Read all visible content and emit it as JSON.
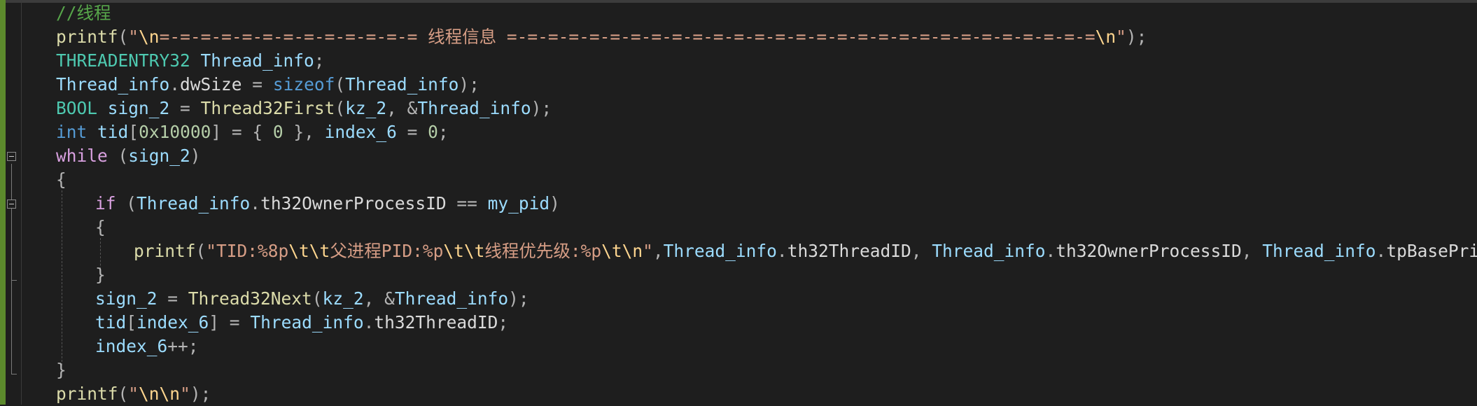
{
  "editor": {
    "lines": [
      {
        "indent": 0,
        "fold": false,
        "tokens": [
          {
            "t": "//线程",
            "c": "cm"
          }
        ]
      },
      {
        "indent": 0,
        "fold": false,
        "tokens": [
          {
            "t": "printf",
            "c": "fn"
          },
          {
            "t": "(",
            "c": "pu"
          },
          {
            "t": "\"",
            "c": "st"
          },
          {
            "t": "\\n",
            "c": "es"
          },
          {
            "t": "=-=-=-=-=-=-=-=-=-=-=-=-= 线程信息 =-=-=-=-=-=-=-=-=-=-=-=-=-=-=-=-=-=-=-=-=-=-=-=-=-=-=-=-=",
            "c": "st"
          },
          {
            "t": "\\n",
            "c": "es"
          },
          {
            "t": "\"",
            "c": "st"
          },
          {
            "t": ");",
            "c": "pu"
          }
        ]
      },
      {
        "indent": 0,
        "fold": false,
        "tokens": [
          {
            "t": "THREADENTRY32",
            "c": "ty"
          },
          {
            "t": " ",
            "c": "df"
          },
          {
            "t": "Thread_info",
            "c": "vr"
          },
          {
            "t": ";",
            "c": "pu"
          }
        ]
      },
      {
        "indent": 0,
        "fold": false,
        "tokens": [
          {
            "t": "Thread_info",
            "c": "vr"
          },
          {
            "t": ".",
            "c": "pu"
          },
          {
            "t": "dwSize",
            "c": "mb"
          },
          {
            "t": " = ",
            "c": "pu"
          },
          {
            "t": "sizeof",
            "c": "kw"
          },
          {
            "t": "(",
            "c": "pu"
          },
          {
            "t": "Thread_info",
            "c": "vr"
          },
          {
            "t": ");",
            "c": "pu"
          }
        ]
      },
      {
        "indent": 0,
        "fold": false,
        "tokens": [
          {
            "t": "BOOL",
            "c": "ty"
          },
          {
            "t": " ",
            "c": "df"
          },
          {
            "t": "sign_2",
            "c": "vr"
          },
          {
            "t": " = ",
            "c": "pu"
          },
          {
            "t": "Thread32First",
            "c": "fn"
          },
          {
            "t": "(",
            "c": "pu"
          },
          {
            "t": "kz_2",
            "c": "vr"
          },
          {
            "t": ", &",
            "c": "pu"
          },
          {
            "t": "Thread_info",
            "c": "vr"
          },
          {
            "t": ");",
            "c": "pu"
          }
        ]
      },
      {
        "indent": 0,
        "fold": false,
        "tokens": [
          {
            "t": "int",
            "c": "kw"
          },
          {
            "t": " ",
            "c": "df"
          },
          {
            "t": "tid",
            "c": "vr"
          },
          {
            "t": "[",
            "c": "pu"
          },
          {
            "t": "0x10000",
            "c": "nm"
          },
          {
            "t": "] = { ",
            "c": "pu"
          },
          {
            "t": "0",
            "c": "nm"
          },
          {
            "t": " }, ",
            "c": "pu"
          },
          {
            "t": "index_6",
            "c": "vr"
          },
          {
            "t": " = ",
            "c": "pu"
          },
          {
            "t": "0",
            "c": "nm"
          },
          {
            "t": ";",
            "c": "pu"
          }
        ]
      },
      {
        "indent": 0,
        "fold": true,
        "tokens": [
          {
            "t": "while",
            "c": "ct"
          },
          {
            "t": " (",
            "c": "pu"
          },
          {
            "t": "sign_2",
            "c": "vr"
          },
          {
            "t": ")",
            "c": "pu"
          }
        ]
      },
      {
        "indent": 0,
        "fold": false,
        "tokens": [
          {
            "t": "{",
            "c": "pu"
          }
        ]
      },
      {
        "indent": 1,
        "fold": true,
        "tokens": [
          {
            "t": "if",
            "c": "ct"
          },
          {
            "t": " (",
            "c": "pu"
          },
          {
            "t": "Thread_info",
            "c": "vr"
          },
          {
            "t": ".",
            "c": "pu"
          },
          {
            "t": "th32OwnerProcessID",
            "c": "mb"
          },
          {
            "t": " == ",
            "c": "pu"
          },
          {
            "t": "my_pid",
            "c": "vr"
          },
          {
            "t": ")",
            "c": "pu"
          }
        ]
      },
      {
        "indent": 1,
        "fold": false,
        "tokens": [
          {
            "t": "{",
            "c": "pu"
          }
        ]
      },
      {
        "indent": 2,
        "fold": false,
        "tokens": [
          {
            "t": "printf",
            "c": "fn"
          },
          {
            "t": "(",
            "c": "pu"
          },
          {
            "t": "\"TID:%8p",
            "c": "st"
          },
          {
            "t": "\\t\\t",
            "c": "es"
          },
          {
            "t": "父进程PID:%p",
            "c": "st"
          },
          {
            "t": "\\t\\t",
            "c": "es"
          },
          {
            "t": "线程优先级:%p",
            "c": "st"
          },
          {
            "t": "\\t\\n",
            "c": "es"
          },
          {
            "t": "\"",
            "c": "st"
          },
          {
            "t": ",",
            "c": "pu"
          },
          {
            "t": "Thread_info",
            "c": "vr"
          },
          {
            "t": ".",
            "c": "pu"
          },
          {
            "t": "th32ThreadID",
            "c": "mb"
          },
          {
            "t": ", ",
            "c": "pu"
          },
          {
            "t": "Thread_info",
            "c": "vr"
          },
          {
            "t": ".",
            "c": "pu"
          },
          {
            "t": "th32OwnerProcessID",
            "c": "mb"
          },
          {
            "t": ", ",
            "c": "pu"
          },
          {
            "t": "Thread_info",
            "c": "vr"
          },
          {
            "t": ".",
            "c": "pu"
          },
          {
            "t": "tpBasePri",
            "c": "mb"
          },
          {
            "t": ");",
            "c": "pu"
          }
        ]
      },
      {
        "indent": 1,
        "fold": false,
        "tokens": [
          {
            "t": "}",
            "c": "pu"
          }
        ]
      },
      {
        "indent": 1,
        "fold": false,
        "tokens": [
          {
            "t": "sign_2",
            "c": "vr"
          },
          {
            "t": " = ",
            "c": "pu"
          },
          {
            "t": "Thread32Next",
            "c": "fn"
          },
          {
            "t": "(",
            "c": "pu"
          },
          {
            "t": "kz_2",
            "c": "vr"
          },
          {
            "t": ", &",
            "c": "pu"
          },
          {
            "t": "Thread_info",
            "c": "vr"
          },
          {
            "t": ");",
            "c": "pu"
          }
        ]
      },
      {
        "indent": 1,
        "fold": false,
        "tokens": [
          {
            "t": "tid",
            "c": "vr"
          },
          {
            "t": "[",
            "c": "pu"
          },
          {
            "t": "index_6",
            "c": "vr"
          },
          {
            "t": "] = ",
            "c": "pu"
          },
          {
            "t": "Thread_info",
            "c": "vr"
          },
          {
            "t": ".",
            "c": "pu"
          },
          {
            "t": "th32ThreadID",
            "c": "mb"
          },
          {
            "t": ";",
            "c": "pu"
          }
        ]
      },
      {
        "indent": 1,
        "fold": false,
        "tokens": [
          {
            "t": "index_6",
            "c": "vr"
          },
          {
            "t": "++;",
            "c": "pu"
          }
        ]
      },
      {
        "indent": 0,
        "fold": false,
        "tokens": [
          {
            "t": "}",
            "c": "pu"
          }
        ]
      },
      {
        "indent": 0,
        "fold": false,
        "tokens": [
          {
            "t": "printf",
            "c": "fn"
          },
          {
            "t": "(",
            "c": "pu"
          },
          {
            "t": "\"",
            "c": "st"
          },
          {
            "t": "\\n\\n",
            "c": "es"
          },
          {
            "t": "\"",
            "c": "st"
          },
          {
            "t": ");",
            "c": "pu"
          }
        ]
      }
    ]
  },
  "colors": {
    "background": "#1e1e1e",
    "comment": "#57a64a",
    "function": "#dcdcaa",
    "string": "#d69d85",
    "escape": "#ffd68f",
    "type": "#4ec9b0",
    "variable": "#9cdcfe",
    "member": "#dadada",
    "keyword": "#569cd6",
    "control": "#d8a0df",
    "number": "#b5cea8",
    "punctuation": "#b4b4b4",
    "change_bar": "#5c8a2c"
  }
}
